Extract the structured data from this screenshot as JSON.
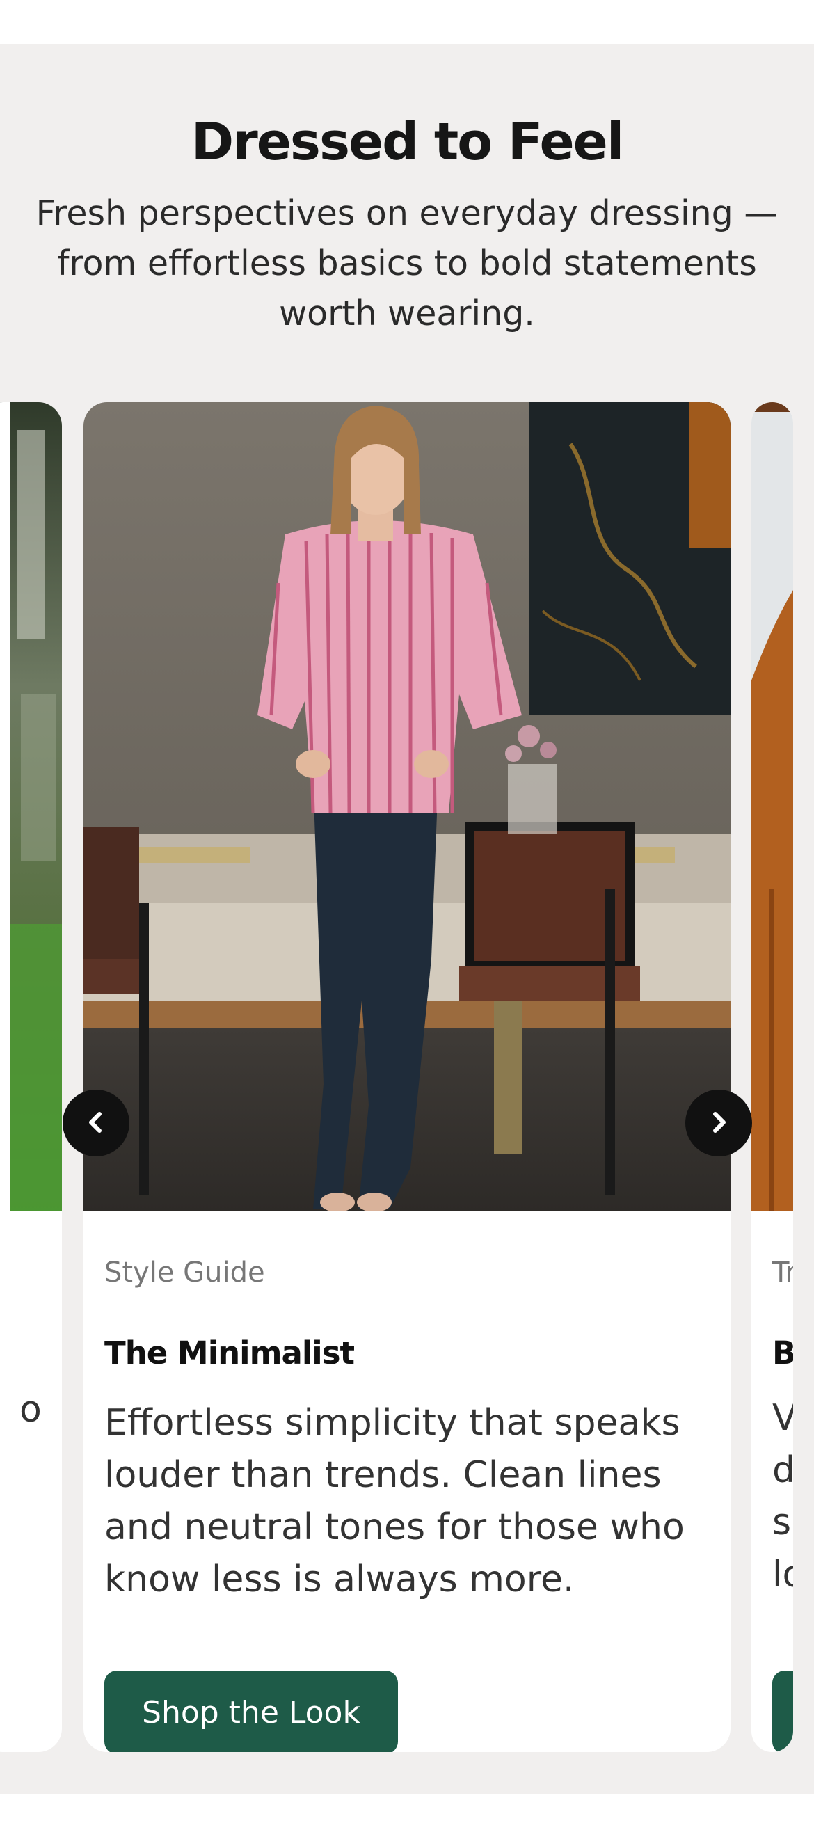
{
  "section": {
    "title": "Dressed to Feel",
    "subtitle": "Fresh perspectives on everyday dressing — from effortless basics to bold statements worth wearing."
  },
  "carousel": {
    "prev_icon": "chevron-left-icon",
    "next_icon": "chevron-right-icon",
    "prev_card": {
      "visible_text": "o"
    },
    "current_card": {
      "category": "Style Guide",
      "title": "The Minimalist",
      "description": "Effortless simplicity that speaks louder than trends. Clean lines and neutral tones for those who know less is always more.",
      "button_label": "Shop the Look"
    },
    "next_card": {
      "category_fragment": "Tr",
      "title_fragment": "B",
      "description_fragments": [
        "V",
        "d",
        "s",
        "lo"
      ]
    }
  },
  "colors": {
    "section_background": "#f1efee",
    "button": "#1e5b48",
    "nav_button": "#111111"
  }
}
